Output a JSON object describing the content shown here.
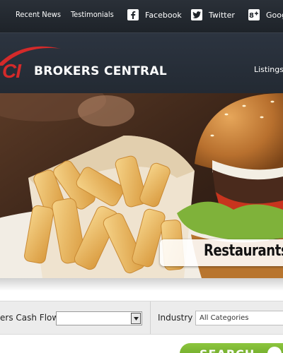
{
  "topbar": {
    "links": [
      "Recent News",
      "Testimonials"
    ],
    "social": [
      {
        "label": "Facebook",
        "icon": "facebook-icon"
      },
      {
        "label": "Twitter",
        "icon": "twitter-icon"
      },
      {
        "label": "Google",
        "icon": "google-plus-icon"
      }
    ]
  },
  "header": {
    "logo_mark": "CI",
    "brand_name": "BROKERS CENTRAL",
    "nav_item": "Listings"
  },
  "hero": {
    "caption": "Restaurants"
  },
  "search": {
    "cash_flow_label": "ers Cash Flow",
    "cash_flow_value": "",
    "industry_label": "Industry",
    "industry_value": "All Categories",
    "button_label": "SEARCH"
  },
  "colors": {
    "topbar_bg": "#1e2329",
    "header_bg": "#2c3440",
    "logo_red": "#d42a2a",
    "search_green": "#7ab82e"
  }
}
